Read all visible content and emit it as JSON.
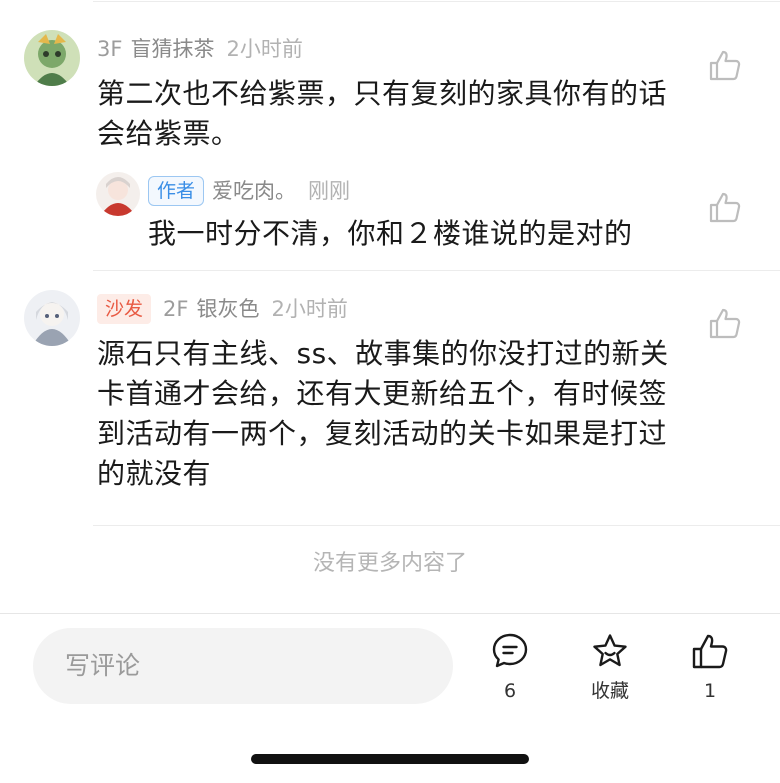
{
  "comments": [
    {
      "floor": "3F",
      "username": "盲猜抹茶",
      "time": "2小时前",
      "lines": [
        "第二次也不给紫票，只有复刻的家具你有的话",
        "会给紫票。"
      ],
      "reply": {
        "tag": "作者",
        "username": "爱吃肉。",
        "time": "刚刚",
        "text": "我一时分不清，你和２楼谁说的是对的"
      }
    },
    {
      "tag": "沙发",
      "floor": "2F",
      "username": "银灰色",
      "time": "2小时前",
      "lines": [
        "源石只有主线、ss、故事集的你没打过的新关",
        "卡首通才会给，还有大更新给五个，有时候签",
        "到活动有一两个，复刻活动的关卡如果是打过",
        "的就没有"
      ]
    }
  ],
  "end_text": "没有更多内容了",
  "bottom_bar": {
    "input_placeholder": "写评论",
    "comment_count": "6",
    "favorite_label": "收藏",
    "like_count": "1"
  },
  "icons": {
    "like": "thumbs-up-icon",
    "comment": "comment-bubble-icon",
    "favorite": "star-icon"
  }
}
